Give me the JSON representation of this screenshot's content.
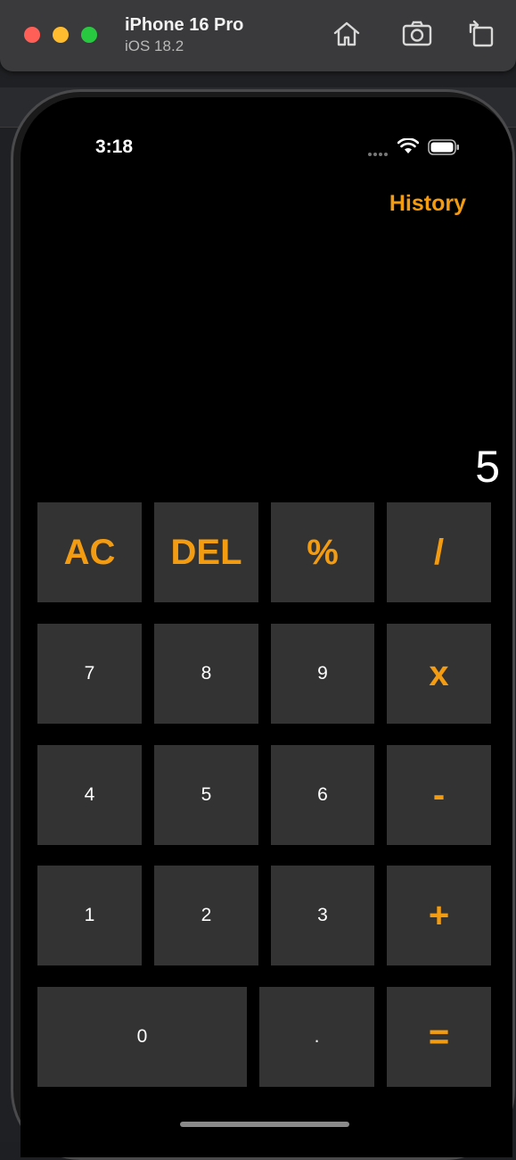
{
  "simulator": {
    "device_name": "iPhone 16 Pro",
    "os_version": "iOS 18.2"
  },
  "status_bar": {
    "time": "3:18"
  },
  "calculator": {
    "history_label": "History",
    "display_value": "5",
    "accent_color": "#f39c12",
    "key_color": "#333333",
    "keys": {
      "ac": "AC",
      "del": "DEL",
      "percent": "%",
      "divide": "/",
      "seven": "7",
      "eight": "8",
      "nine": "9",
      "multiply": "x",
      "four": "4",
      "five": "5",
      "six": "6",
      "minus": "-",
      "one": "1",
      "two": "2",
      "three": "3",
      "plus": "+",
      "zero": "0",
      "decimal": ".",
      "equals": "="
    }
  }
}
